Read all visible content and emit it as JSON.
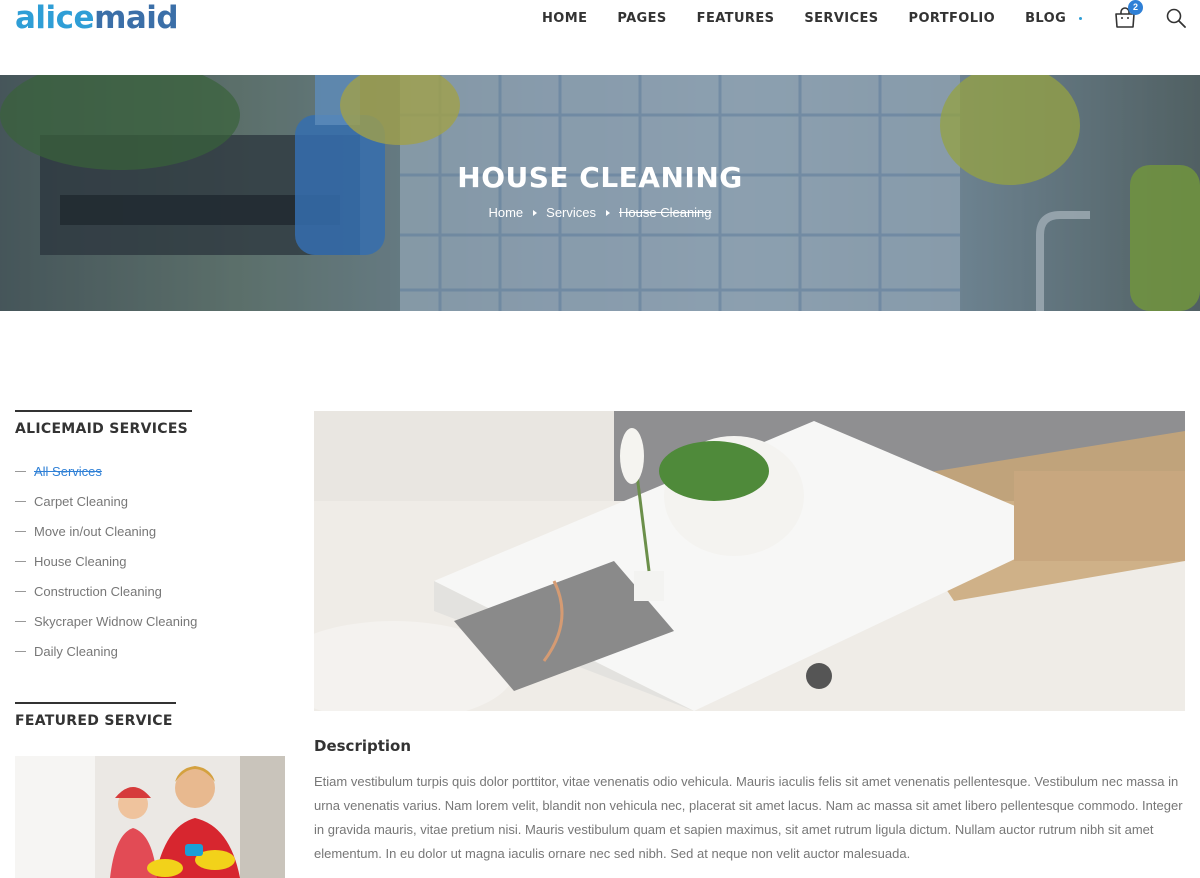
{
  "header": {
    "logo_part1": "alice",
    "logo_part2": "maid",
    "nav": [
      "HOME",
      "PAGES",
      "FEATURES",
      "SERVICES",
      "PORTFOLIO",
      "BLOG"
    ],
    "cart_count": "2",
    "icons": [
      "cart-icon",
      "search-icon"
    ]
  },
  "hero": {
    "title": "HOUSE CLEANING",
    "breadcrumb": [
      "Home",
      "Services",
      "House Cleaning"
    ]
  },
  "sidebar": {
    "services_title": "ALICEMAID SERVICES",
    "services": [
      "All Services",
      "Carpet Cleaning",
      "Move in/out Cleaning",
      "House Cleaning",
      "Construction Cleaning",
      "Skycraper Widnow Cleaning",
      "Daily Cleaning"
    ],
    "featured_title": "FEATURED SERVICE"
  },
  "main": {
    "description_title": "Description",
    "description_text": "Etiam vestibulum turpis quis dolor porttitor, vitae venenatis odio vehicula. Mauris iaculis felis sit amet venenatis pellentesque. Vestibulum nec massa in urna venenatis varius. Nam lorem velit, blandit non vehicula nec, placerat sit amet lacus. Nam ac massa sit amet libero pellentesque commodo. Integer in gravida mauris, vitae pretium nisi. Mauris vestibulum quam et sapien maximus, sit amet rutrum ligula dictum. Nullam auctor rutrum nibh sit amet elementum. In eu dolor ut magna iaculis ornare nec sed nibh. Sed at neque non velit auctor malesuada."
  },
  "colors": {
    "accent": "#2f80d6",
    "logo_light": "#2f9ed6",
    "logo_dark": "#3b6fa8"
  }
}
